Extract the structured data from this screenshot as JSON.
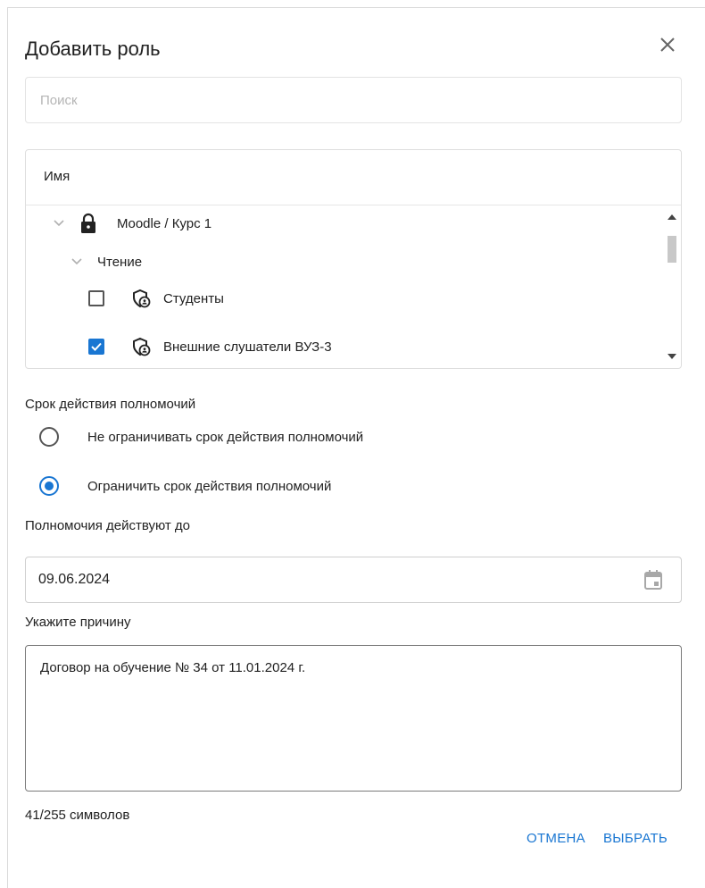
{
  "dialog": {
    "title": "Добавить роль",
    "close_icon": "close-icon"
  },
  "search": {
    "placeholder": "Поиск",
    "value": ""
  },
  "table": {
    "header": "Имя",
    "tree": {
      "root_label": "Moodle / Курс 1",
      "root_icon": "lock-icon",
      "group_label": "Чтение",
      "items": [
        {
          "label": "Студенты",
          "checked": false,
          "icon": "shield-user-icon"
        },
        {
          "label": "Внешние слушатели ВУЗ-3",
          "checked": true,
          "icon": "shield-user-icon"
        }
      ]
    }
  },
  "term": {
    "label": "Срок действия полномочий",
    "options": [
      {
        "label": "Не ограничивать срок действия полномочий",
        "selected": false
      },
      {
        "label": "Ограничить срок действия полномочий",
        "selected": true
      }
    ]
  },
  "valid_until": {
    "label": "Полномочия действуют до",
    "value": "09.06.2024",
    "icon": "calendar-icon"
  },
  "reason": {
    "label": "Укажите причину",
    "value": "Договор на обучение № 34 от 11.01.2024 г.",
    "counter": "41/255 символов"
  },
  "actions": {
    "cancel": "ОТМЕНА",
    "select": "ВЫБРАТЬ"
  },
  "colors": {
    "accent": "#1976d2"
  }
}
